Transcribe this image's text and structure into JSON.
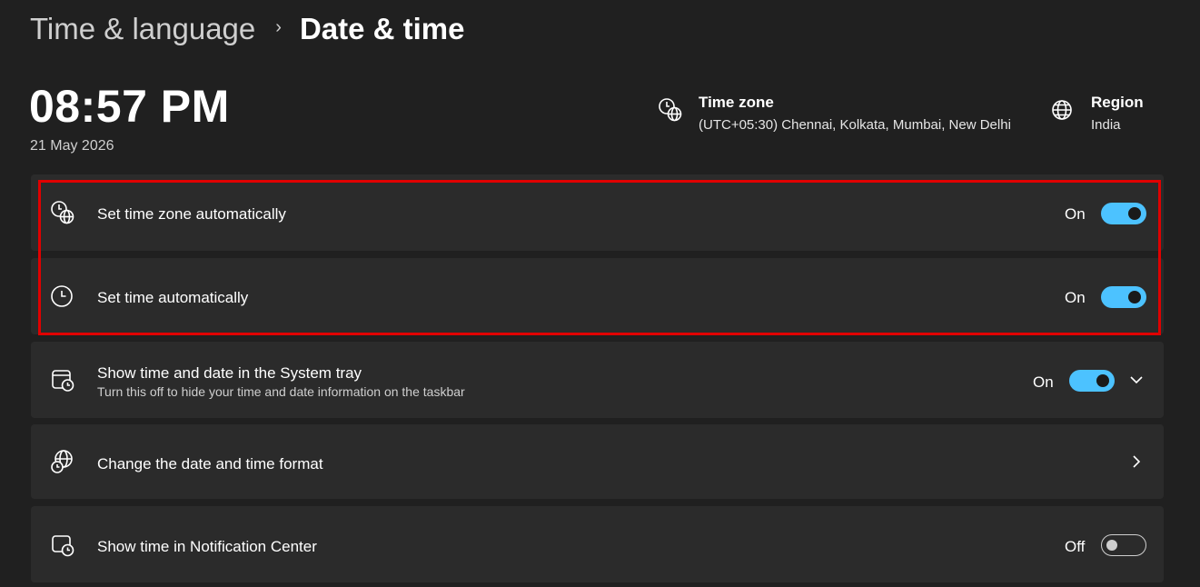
{
  "breadcrumb": {
    "parent": "Time & language",
    "separator": "›",
    "current": "Date & time"
  },
  "clock": {
    "time": "08:57 PM",
    "date": "21 May 2026"
  },
  "header_info": {
    "time_zone": {
      "title": "Time zone",
      "value": "(UTC+05:30) Chennai, Kolkata, Mumbai, New Delhi",
      "icon": "clock-globe-icon"
    },
    "region": {
      "title": "Region",
      "value": "India",
      "icon": "globe-icon"
    }
  },
  "settings": [
    {
      "label": "Set time zone automatically",
      "state": "On",
      "toggle": true,
      "icon": "clock-globe-icon"
    },
    {
      "label": "Set time automatically",
      "state": "On",
      "toggle": true,
      "icon": "clock-icon"
    },
    {
      "label": "Show time and date in the System tray",
      "sublabel": "Turn this off to hide your time and date information on the taskbar",
      "state": "On",
      "toggle": true,
      "expand": true,
      "icon": "calendar-clock-icon"
    },
    {
      "label": "Change the date and time format",
      "navigate": true,
      "icon": "globe-clock-icon"
    },
    {
      "label": "Show time in Notification Center",
      "state": "Off",
      "toggle": false,
      "icon": "notification-clock-icon"
    }
  ],
  "colors": {
    "background": "#202020",
    "card": "#2b2b2b",
    "accent": "#4cc2ff",
    "highlight": "#e00000"
  }
}
